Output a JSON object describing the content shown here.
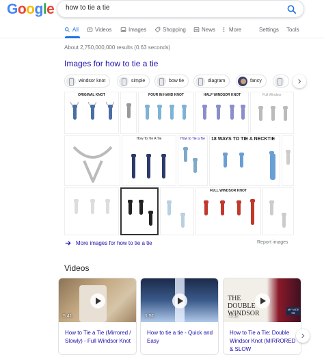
{
  "logo": {
    "letters": [
      "G",
      "o",
      "o",
      "g",
      "l",
      "e"
    ],
    "colors": [
      "#4285f4",
      "#ea4335",
      "#fbbc05",
      "#4285f4",
      "#34a853",
      "#ea4335"
    ]
  },
  "search": {
    "query": "how to tie a tie",
    "icon": "search-icon",
    "accent": "#1a73e8"
  },
  "tabs": {
    "all": "All",
    "videos": "Videos",
    "images": "Images",
    "shopping": "Shopping",
    "news": "News",
    "more": "More",
    "settings": "Settings",
    "tools": "Tools"
  },
  "results_count": "About 2,750,000,000 results (0.63 seconds)",
  "images_section": {
    "heading": "Images for how to tie a tie",
    "chips": [
      "windsor knot",
      "simple",
      "bow tie",
      "diagram",
      "fancy"
    ],
    "tiles": [
      {
        "title": "ORIGINAL KNOT"
      },
      {
        "title": ""
      },
      {
        "title": "FOUR IN HAND KNOT"
      },
      {
        "title": "HALF WINDSOR KNOT"
      },
      {
        "title": "Full Windsor"
      },
      {
        "title": ""
      },
      {
        "title": "How To Tie A Tie"
      },
      {
        "title": "How to Tie a Tie"
      },
      {
        "title": "18 WAYS TO TIE A NECKTIE"
      },
      {
        "title": ""
      },
      {
        "title": ""
      },
      {
        "title": ""
      },
      {
        "title": ""
      },
      {
        "title": "FULL WINDSOR KNOT"
      },
      {
        "title": ""
      }
    ],
    "more_link": "More images for how to tie a tie",
    "report": "Report images"
  },
  "videos_section": {
    "heading": "Videos",
    "cards": [
      {
        "duration": "5:41",
        "title": "How to Tie a Tie (Mirrored / Slowly) - Full Windsor Knot",
        "thumb_text": ""
      },
      {
        "duration": "1:51",
        "title": "How to tie a tie - Quick and Easy",
        "thumb_text": ""
      },
      {
        "duration": "4:48",
        "title": "How to Tie a Tie: Double Windsor Knot (MIRRORED & SLOW",
        "thumb_text": "THE DOUBLE WINDSOR",
        "badge": "MY NICE TIE"
      }
    ]
  }
}
